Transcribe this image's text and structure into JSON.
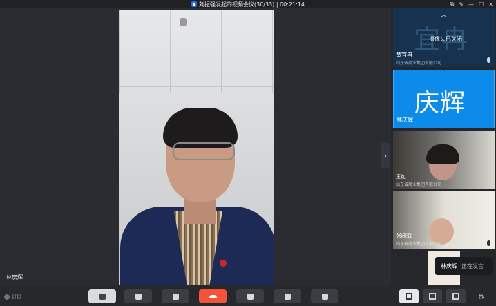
{
  "window": {
    "title": "刘振强发起的视频会议(30/33) | 00:21:14",
    "controls": [
      "⧉",
      "✎",
      "—",
      "☐",
      "✕"
    ]
  },
  "main_video": {
    "speaker_label": "林庆辉"
  },
  "sidebar": {
    "participants": [
      {
        "bg_text": "宜冉",
        "note": "摄像头已关闭",
        "name": "黄宜冉",
        "org": "山东省商业集团有限公司"
      },
      {
        "avatar_text": "庆辉",
        "name": "林庆辉"
      },
      {
        "name": "王红",
        "org": "山东省商业集团有限公司"
      },
      {
        "name": "张晓辉",
        "org": "山东省商业集团有限公司"
      }
    ]
  },
  "speaking_indicator": {
    "name": "林庆辉",
    "status": "正在发言"
  },
  "toolbar": {
    "brand": "钉钉",
    "buttons": [
      "mic-mute",
      "camera",
      "share-screen",
      "end-call",
      "add-member",
      "members",
      "record"
    ]
  },
  "colors": {
    "accent": "#0c8bea",
    "end_call": "#f2533a"
  }
}
